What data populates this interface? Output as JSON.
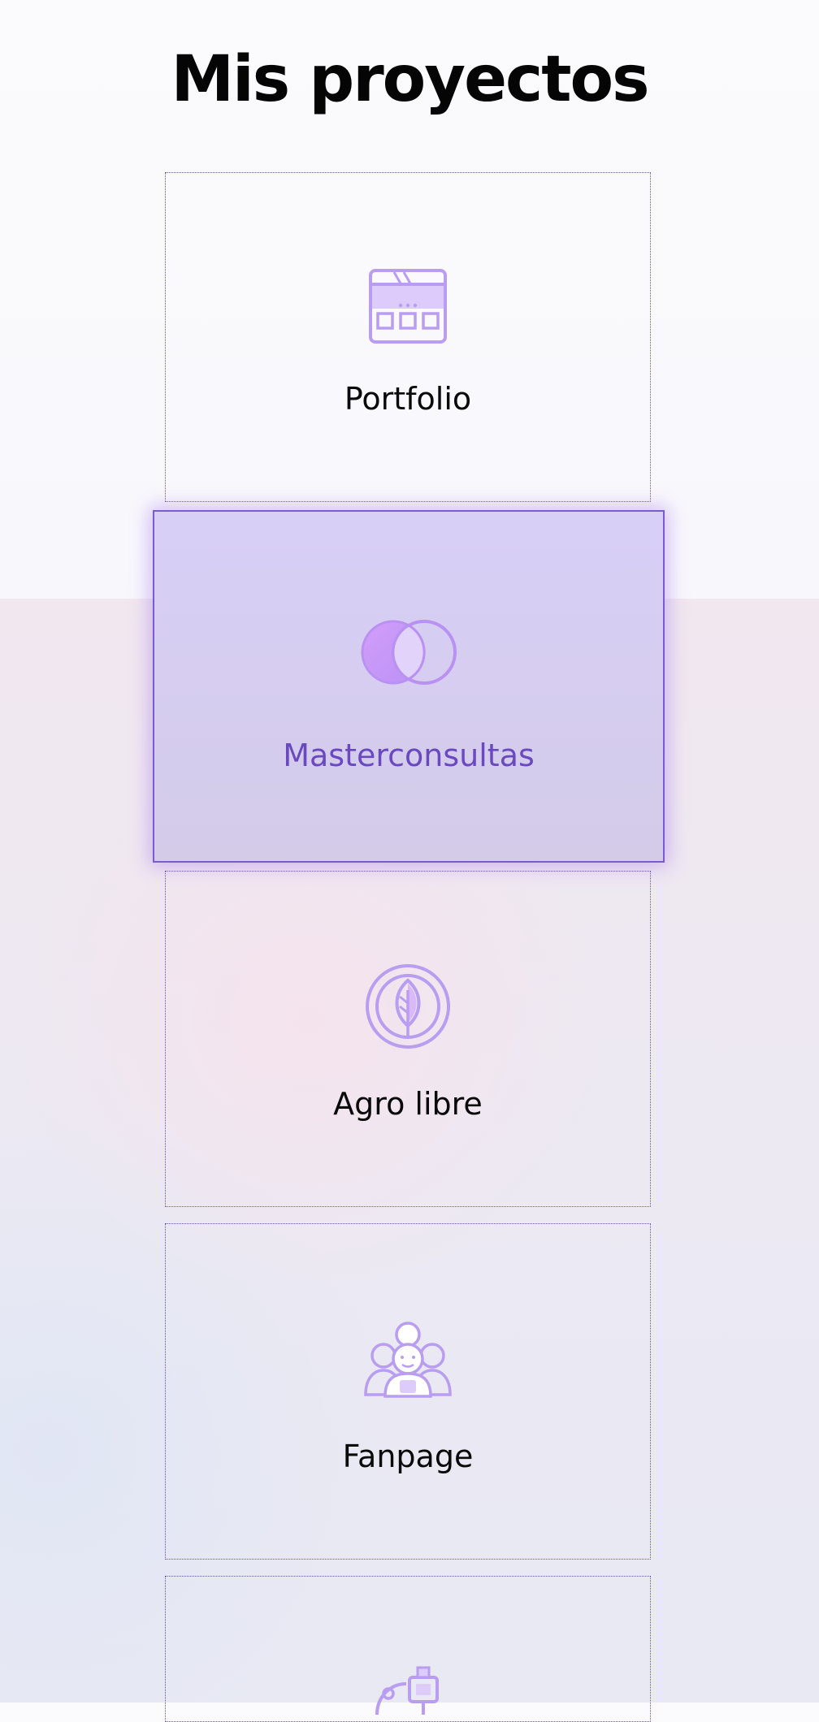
{
  "page": {
    "title": "Mis proyectos"
  },
  "projects": [
    {
      "label": "Portfolio",
      "icon": "browser-window-icon"
    },
    {
      "label": "Masterconsultas",
      "icon": "overlapping-circles-icon",
      "state": "hover"
    },
    {
      "label": "Agro libre",
      "icon": "leaf-icon"
    },
    {
      "label": "Fanpage",
      "icon": "people-group-icon"
    },
    {
      "label": "",
      "icon": "robot-arm-icon"
    }
  ],
  "colors": {
    "accent": "#6a48c0",
    "icon": "#b79cf0",
    "border": "#6a4fc2",
    "active_bg": "#d8cff7"
  }
}
